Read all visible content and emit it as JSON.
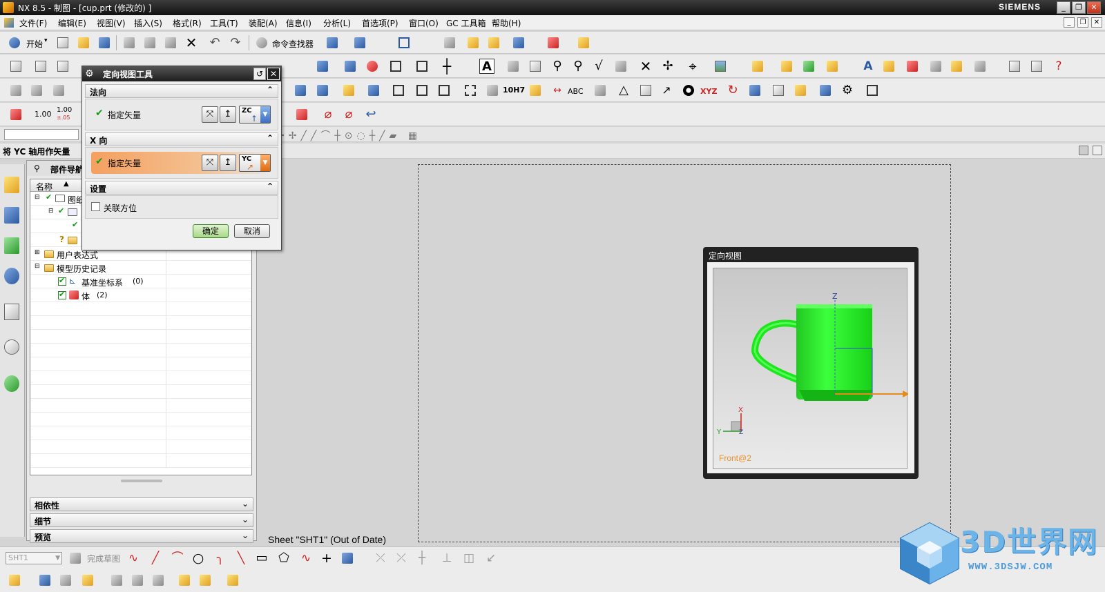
{
  "window": {
    "title": "NX 8.5 - 制图 - [cup.prt  (修改的) ]",
    "brand": "SIEMENS"
  },
  "menu": [
    "文件(F)",
    "编辑(E)",
    "视图(V)",
    "插入(S)",
    "格式(R)",
    "工具(T)",
    "装配(A)",
    "信息(I)",
    "分析(L)",
    "首选项(P)",
    "窗口(O)",
    "GC 工具箱",
    "帮助(H)"
  ],
  "toolbar": {
    "start_label": "开始",
    "command_finder_label": "命令查找器",
    "val1": "1.00",
    "val2_top": "1.00",
    "val2_bottom": "±.05",
    "val3": "10H7",
    "abc": "ABC",
    "xyz": "XYZ"
  },
  "status_hint": "将 YC 轴用作矢量",
  "navigator": {
    "title": "部件导航器",
    "column_name": "名称",
    "items": [
      {
        "label": "图纸"
      },
      {
        "label": ""
      },
      {
        "label": ""
      },
      {
        "label": ""
      },
      {
        "label": "用户表达式"
      },
      {
        "label": "模型历史记录"
      },
      {
        "label": "基准坐标系",
        "count": "(0)"
      },
      {
        "label": "体",
        "count": "(2)"
      }
    ],
    "panels": [
      "相依性",
      "细节",
      "预览"
    ]
  },
  "dialog": {
    "title": "定向视图工具",
    "sections": {
      "normal": "法向",
      "x_dir": "X 向",
      "settings": "设置"
    },
    "specify_vector": "指定矢量",
    "normal_vector_code": "ZC",
    "x_vector_code": "YC",
    "associate_label": "关联方位",
    "associate_checked": false,
    "ok": "确定",
    "cancel": "取消"
  },
  "view_window": {
    "title": "定向视图",
    "view_name": "Front@2",
    "axis_z": "Z",
    "triad_x": "X",
    "triad_y": "Y",
    "triad_z": "Z",
    "body_color": "#1ee61e"
  },
  "sheet_status": "Sheet \"SHT1\" (Out of Date)",
  "bottom_toolbar": {
    "sheet_select": "SHT1",
    "finish_sketch": "完成草图"
  },
  "watermark": {
    "text": "3D世界网",
    "url": "WWW.3DSJW.COM"
  }
}
